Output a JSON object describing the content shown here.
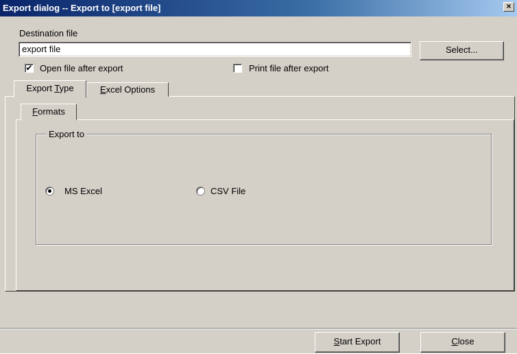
{
  "window": {
    "title": "Export dialog -- Export to [export file]",
    "close_glyph": "×"
  },
  "destination": {
    "label": "Destination file",
    "value": "export file",
    "select_button": "Select..."
  },
  "options": {
    "open_after_export": {
      "label": "Open file after export",
      "checked": true
    },
    "print_after_export": {
      "label": "Print file after export",
      "checked": false
    }
  },
  "tabs": {
    "export_type": {
      "prefix": "Export ",
      "accel": "T",
      "suffix": "ype"
    },
    "excel_options": {
      "accel": "E",
      "suffix": "xcel Options"
    }
  },
  "subtabs": {
    "formats": {
      "accel": "F",
      "suffix": "ormats"
    }
  },
  "export_to": {
    "label": "Export to",
    "ms_excel": {
      "label": "MS Excel",
      "selected": true
    },
    "csv_file": {
      "label": "CSV File",
      "selected": false
    }
  },
  "footer": {
    "start_export": {
      "accel": "S",
      "suffix": "tart Export"
    },
    "close": {
      "accel": "C",
      "suffix": "lose"
    }
  },
  "icons": {
    "checkmark": "check-icon"
  }
}
